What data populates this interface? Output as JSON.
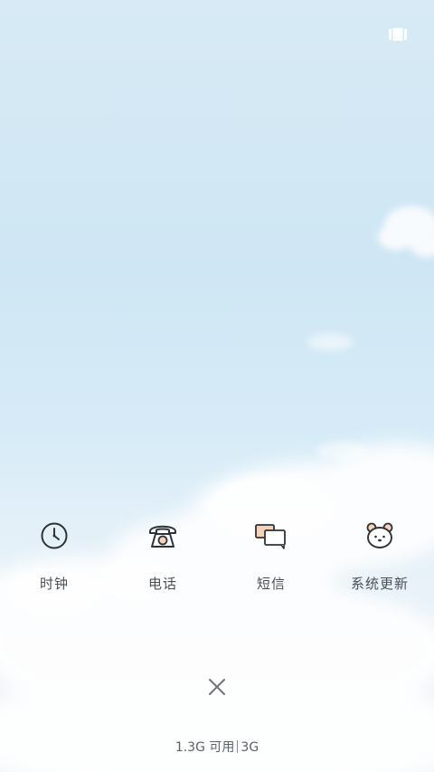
{
  "top_right": {
    "icon": "recent-apps-icon"
  },
  "apps": [
    {
      "label": "时钟",
      "icon": "clock-icon"
    },
    {
      "label": "电话",
      "icon": "phone-icon"
    },
    {
      "label": "短信",
      "icon": "message-icon"
    },
    {
      "label": "系统更新",
      "icon": "bear-icon"
    }
  ],
  "close": {
    "icon": "close-icon"
  },
  "memory": {
    "available": "1.3G 可用",
    "total": "3G"
  },
  "colors": {
    "sky_top": "#d7eaf5",
    "sky_bottom": "#f3f7fa",
    "icon_stroke": "#2f3338",
    "label_text": "#4a4f55",
    "accent_peach": "#f6d2b8"
  }
}
